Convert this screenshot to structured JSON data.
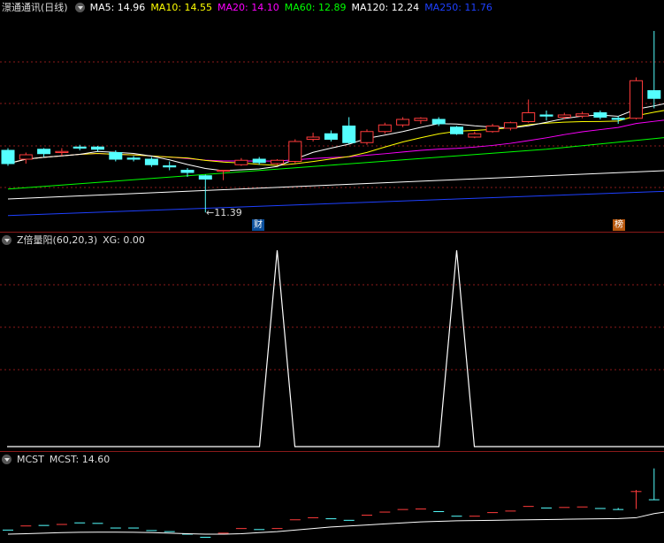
{
  "main": {
    "title": "澋通通讯(日线)",
    "ma": [
      {
        "label": "MA5: 14.96",
        "color": "#ffffff"
      },
      {
        "label": "MA10: 14.55",
        "color": "#ffff00"
      },
      {
        "label": "MA20: 14.10",
        "color": "#ff00ff"
      },
      {
        "label": "MA60: 12.89",
        "color": "#00ff00"
      },
      {
        "label": "MA120: 12.24",
        "color": "#ffffff"
      },
      {
        "label": "MA250: 11.76",
        "color": "#1e40ff"
      }
    ],
    "low_marker": "←11.39",
    "badge_cai": "财",
    "badge_bang": "榜"
  },
  "indicator": {
    "title": "Z倍量阳(60,20,3)",
    "xg_label": "XG: 0.00"
  },
  "mcst": {
    "title": "MCST",
    "value_label": "MCST: 14.60"
  },
  "colors": {
    "up": "#ff3b3b",
    "down": "#54ffff",
    "grid": "#8b1a1a"
  },
  "candles": [
    {
      "o": 14.2,
      "c": 13.6,
      "h": 14.3,
      "l": 13.5
    },
    {
      "o": 13.8,
      "c": 14.0,
      "h": 14.1,
      "l": 13.6
    },
    {
      "o": 14.25,
      "c": 14.05,
      "h": 14.3,
      "l": 13.9
    },
    {
      "o": 14.1,
      "c": 14.15,
      "h": 14.3,
      "l": 13.95
    },
    {
      "o": 14.35,
      "c": 14.3,
      "h": 14.45,
      "l": 14.2
    },
    {
      "o": 14.35,
      "c": 14.25,
      "h": 14.4,
      "l": 14.15
    },
    {
      "o": 14.1,
      "c": 13.8,
      "h": 14.2,
      "l": 13.7
    },
    {
      "o": 13.85,
      "c": 13.8,
      "h": 13.95,
      "l": 13.7
    },
    {
      "o": 13.8,
      "c": 13.55,
      "h": 13.9,
      "l": 13.45
    },
    {
      "o": 13.5,
      "c": 13.45,
      "h": 13.7,
      "l": 13.3
    },
    {
      "o": 13.3,
      "c": 13.2,
      "h": 13.4,
      "l": 13.0
    },
    {
      "o": 13.05,
      "c": 12.9,
      "h": 13.1,
      "l": 11.39
    },
    {
      "o": 13.3,
      "c": 13.3,
      "h": 13.3,
      "l": 12.85
    },
    {
      "o": 13.55,
      "c": 13.75,
      "h": 13.85,
      "l": 13.5
    },
    {
      "o": 13.8,
      "c": 13.65,
      "h": 13.9,
      "l": 13.55
    },
    {
      "o": 13.6,
      "c": 13.75,
      "h": 13.8,
      "l": 13.55
    },
    {
      "o": 13.7,
      "c": 14.6,
      "h": 14.7,
      "l": 13.6
    },
    {
      "o": 14.7,
      "c": 14.8,
      "h": 15.0,
      "l": 14.6
    },
    {
      "o": 14.95,
      "c": 14.7,
      "h": 15.1,
      "l": 14.6
    },
    {
      "o": 15.3,
      "c": 14.55,
      "h": 15.7,
      "l": 14.5
    },
    {
      "o": 14.55,
      "c": 15.05,
      "h": 15.15,
      "l": 14.45
    },
    {
      "o": 15.05,
      "c": 15.35,
      "h": 15.45,
      "l": 14.95
    },
    {
      "o": 15.35,
      "c": 15.6,
      "h": 15.7,
      "l": 15.25
    },
    {
      "o": 15.55,
      "c": 15.65,
      "h": 15.7,
      "l": 15.4
    },
    {
      "o": 15.6,
      "c": 15.4,
      "h": 15.7,
      "l": 15.3
    },
    {
      "o": 15.25,
      "c": 14.95,
      "h": 15.3,
      "l": 14.9
    },
    {
      "o": 14.8,
      "c": 14.95,
      "h": 15.05,
      "l": 14.75
    },
    {
      "o": 15.05,
      "c": 15.3,
      "h": 15.4,
      "l": 15.0
    },
    {
      "o": 15.2,
      "c": 15.45,
      "h": 15.5,
      "l": 15.1
    },
    {
      "o": 15.5,
      "c": 15.9,
      "h": 16.5,
      "l": 15.45
    },
    {
      "o": 15.8,
      "c": 15.75,
      "h": 16.0,
      "l": 15.55
    },
    {
      "o": 15.7,
      "c": 15.8,
      "h": 15.9,
      "l": 15.6
    },
    {
      "o": 15.75,
      "c": 15.85,
      "h": 15.95,
      "l": 15.65
    },
    {
      "o": 15.9,
      "c": 15.7,
      "h": 16.0,
      "l": 15.6
    },
    {
      "o": 15.65,
      "c": 15.6,
      "h": 15.75,
      "l": 15.4
    },
    {
      "o": 15.65,
      "c": 17.35,
      "h": 17.5,
      "l": 15.6
    },
    {
      "o": 16.9,
      "c": 16.55,
      "h": 19.6,
      "l": 16.1
    },
    {
      "o": 16.3,
      "c": 16.7,
      "h": 17.6,
      "l": 15.9
    },
    {
      "o": 16.4,
      "c": 17.2,
      "h": 17.8,
      "l": 16.2
    }
  ],
  "xg_spikes": [
    15,
    25
  ],
  "mcst_values": [
    13.2,
    13.25,
    13.3,
    13.35,
    13.38,
    13.4,
    13.4,
    13.38,
    13.35,
    13.3,
    13.25,
    13.2,
    13.2,
    13.25,
    13.35,
    13.45,
    13.6,
    13.75,
    13.9,
    14.0,
    14.1,
    14.2,
    14.3,
    14.4,
    14.45,
    14.5,
    14.52,
    14.55,
    14.58,
    14.6,
    14.62,
    14.65,
    14.68,
    14.7,
    14.72,
    14.8,
    15.2,
    15.45,
    15.6
  ]
}
